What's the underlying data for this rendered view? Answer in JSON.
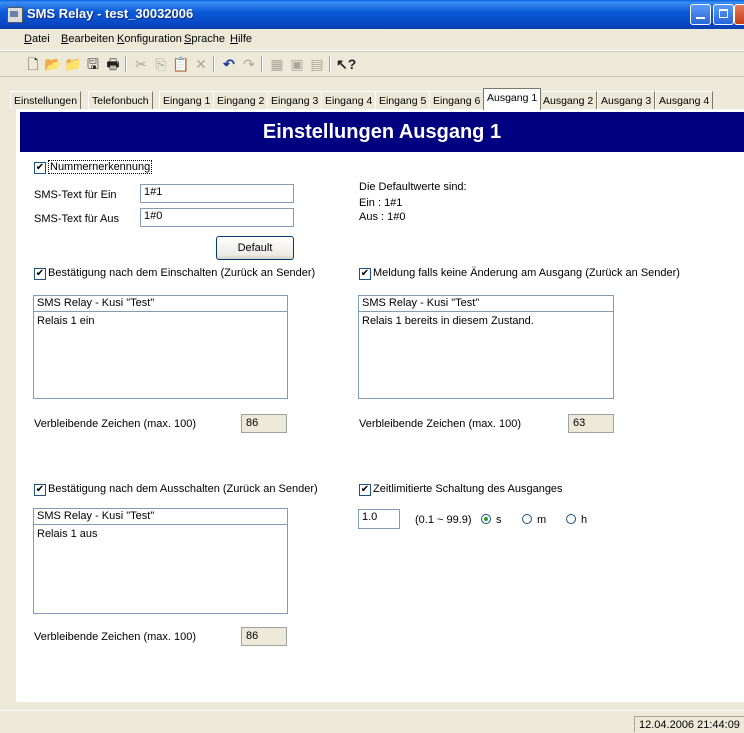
{
  "window": {
    "title": "SMS Relay - test_30032006"
  },
  "menu": [
    {
      "label": "Datei",
      "u": "D",
      "rest": "atei"
    },
    {
      "label": "Bearbeiten",
      "u": "B",
      "rest": "earbeiten"
    },
    {
      "label": "Konfiguration",
      "u": "K",
      "rest": "onfiguration"
    },
    {
      "label": "Sprache",
      "u": "S",
      "rest": "prache"
    },
    {
      "label": "Hilfe",
      "u": "H",
      "rest": "ilfe"
    }
  ],
  "tabs": [
    "Einstellungen",
    "Telefonbuch",
    "Eingang 1",
    "Eingang 2",
    "Eingang 3",
    "Eingang 4",
    "Eingang 5",
    "Eingang 6",
    "Ausgang 1",
    "Ausgang 2",
    "Ausgang 3",
    "Ausgang 4"
  ],
  "header": "Einstellungen Ausgang 1",
  "nummernerkennung": {
    "label": "Nummernerkennung",
    "checked": true
  },
  "sms_ein": {
    "label": "SMS-Text für Ein",
    "value": "1#1"
  },
  "sms_aus": {
    "label": "SMS-Text für Aus",
    "value": "1#0"
  },
  "defaults": {
    "line1": "Die Defaultwerte sind:",
    "line2": "Ein : 1#1",
    "line3": "Aus : 1#0"
  },
  "default_button": "Default",
  "confirm_on": {
    "label": "Bestätigung nach dem Einschalten (Zurück an Sender)",
    "line1": "SMS Relay - Kusi \"Test\"",
    "line2": "Relais 1 ein",
    "remaining_label": "Verbleibende Zeichen (max. 100)",
    "remaining": "86"
  },
  "notify_nochange": {
    "label": "Meldung falls keine Änderung am Ausgang (Zurück an Sender)",
    "line1": "SMS Relay - Kusi \"Test\"",
    "line2": "Relais 1 bereits in diesem Zustand.",
    "remaining_label": "Verbleibende Zeichen (max. 100)",
    "remaining": "63"
  },
  "confirm_off": {
    "label": "Bestätigung nach dem Ausschalten (Zurück an Sender)",
    "line1": "SMS Relay - Kusi \"Test\"",
    "line2": "Relais 1 aus",
    "remaining_label": "Verbleibende Zeichen (max. 100)",
    "remaining": "86"
  },
  "timed": {
    "label": "Zeitlimitierte Schaltung des Ausganges",
    "value": "1.0",
    "range": "(0.1 ~ 99.9)",
    "unit_s": "s",
    "unit_m": "m",
    "unit_h": "h",
    "selected": "s"
  },
  "status": {
    "datetime": "12.04.2006 21:44:09"
  }
}
